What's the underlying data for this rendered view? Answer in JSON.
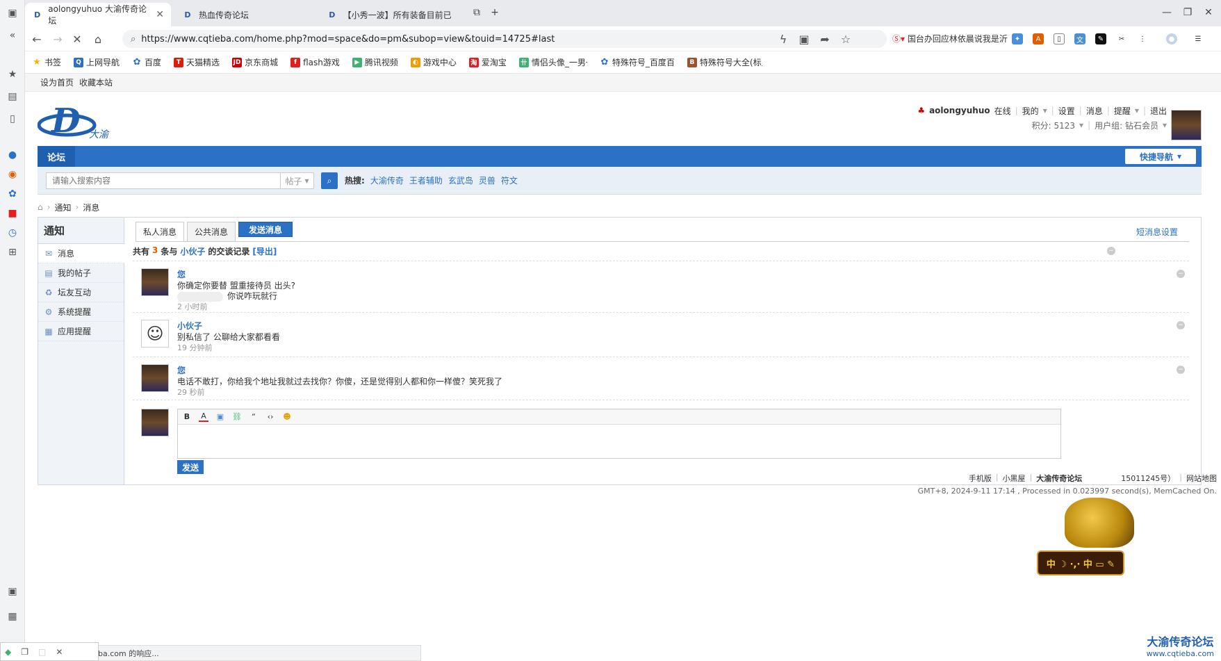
{
  "tabs": [
    {
      "title": "aolongyuhuo 大渝传奇论坛",
      "active": true
    },
    {
      "title": "热血传奇论坛",
      "active": false
    },
    {
      "title": "【小秀一波】所有装备目前已经",
      "active": false
    }
  ],
  "address": {
    "url": "https://www.cqtieba.com/home.php?mod=space&do=pm&subop=view&touid=14725#last",
    "news": "国台办回应林依晨说我是沂"
  },
  "bookmarks": [
    "书签",
    "上网导航",
    "百度",
    "天猫精选",
    "京东商城",
    "flash游戏",
    "腾讯视频",
    "游戏中心",
    "爱淘宝",
    "情侣头像_一男一女",
    "特殊符号_百度百科",
    "特殊符号大全(标点"
  ],
  "topbar": {
    "set_home": "设为首页",
    "favorite": "收藏本站"
  },
  "logo": {
    "letter": "D",
    "text": "大渝"
  },
  "user": {
    "name": "aolongyuhuo",
    "status": "在线",
    "links": [
      "我的",
      "设置",
      "消息",
      "提醒",
      "退出"
    ],
    "credits": "积分: 5123",
    "group": "用户组: 钻石会员"
  },
  "nav": {
    "forum": "论坛",
    "quick_nav": "快捷导航"
  },
  "search": {
    "placeholder": "请输入搜索内容",
    "type": "帖子",
    "hot_label": "热搜:",
    "hot": [
      "大渝传奇",
      "王者辅助",
      "玄武岛",
      "灵兽",
      "符文"
    ]
  },
  "breadcrumb": {
    "notice": "通知",
    "message": "消息"
  },
  "sidebar": {
    "title": "通知",
    "items": [
      "消息",
      "我的帖子",
      "坛友互动",
      "系统提醒",
      "应用提醒"
    ]
  },
  "pm": {
    "tab_private": "私人消息",
    "tab_public": "公共消息",
    "send_message": "发送消息",
    "settings": "短消息设置",
    "summary_prefix": "共有",
    "count": "3",
    "summary_mid": "条与",
    "peer": "小伙子",
    "summary_suffix": "的交谈记录",
    "export": "[导出]",
    "messages": [
      {
        "from": "您",
        "lines": [
          "你确定你要替 盟重接待员 出头?",
          "你说咋玩就行"
        ],
        "time": "2 小时前"
      },
      {
        "from": "小伙子",
        "lines": [
          "别私信了   公聊给大家都看看"
        ],
        "time": "19 分钟前"
      },
      {
        "from": "您",
        "lines": [
          "电话不敢打，你给我个地址我就过去找你？你傻，还是觉得别人都和你一样傻？笑死我了"
        ],
        "time": "29 秒前"
      }
    ],
    "send": "发送"
  },
  "footer": {
    "links": [
      "手机版",
      "小黑屋",
      "大渝传奇论坛",
      "15011245号）",
      "网站地图"
    ],
    "line2": "GMT+8, 2024-9-11 17:14 , Processed in 0.023997 second(s), MemCached On."
  },
  "mascot": {
    "label": "中 ☽ ·,· 中 ▭ ✎"
  },
  "watermark": {
    "name": "大渝传奇论坛",
    "domain": "www.cqtieba.com"
  },
  "status": "ba.com 的响应..."
}
